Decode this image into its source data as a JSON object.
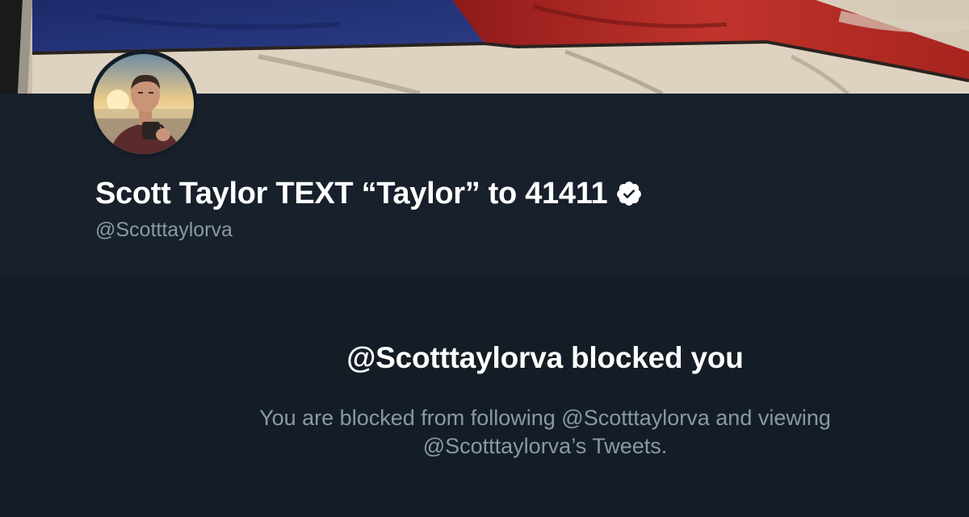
{
  "profile": {
    "display_name": "Scott Taylor TEXT “Taylor” to 41411",
    "handle": "@Scotttaylorva",
    "verified_icon": "verified-badge-icon"
  },
  "blocked": {
    "title": "@Scotttaylorva blocked you",
    "description_line1": "You are blocked from following @Scotttaylorva and viewing",
    "description_line2": "@Scotttaylorva’s Tweets."
  },
  "colors": {
    "background": "#141d26",
    "header_band": "#17202b",
    "primary_text": "#ffffff",
    "secondary_text": "#8899a6"
  }
}
